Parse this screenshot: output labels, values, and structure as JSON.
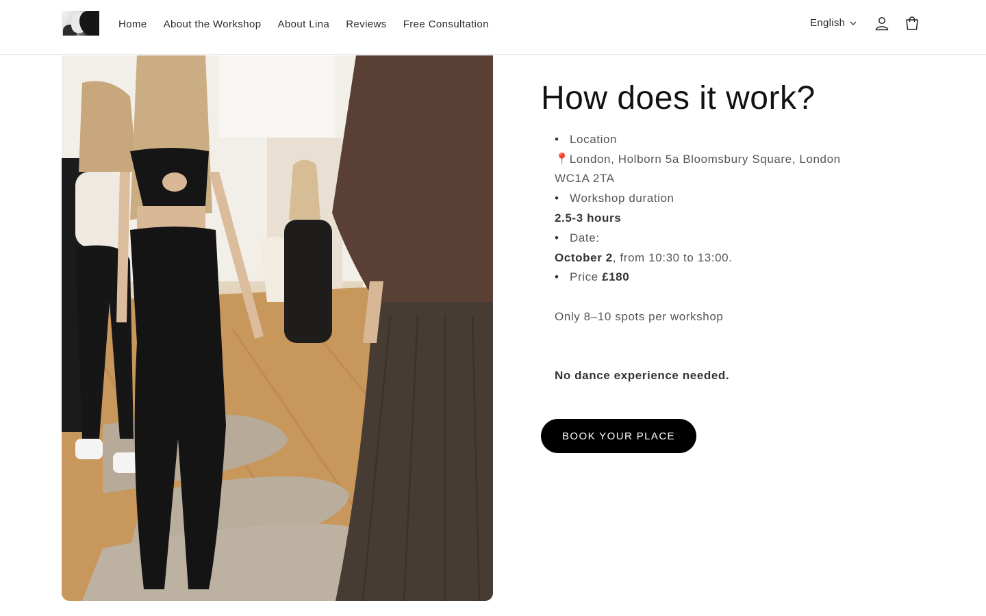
{
  "header": {
    "nav": [
      "Home",
      "About the Workshop",
      "About Lina",
      "Reviews",
      "Free Consultation"
    ],
    "language": "English",
    "icons": {
      "account": "account-icon",
      "cart": "cart-icon",
      "language_chevron": "chevron-down-icon"
    }
  },
  "main": {
    "title": "How does it work?",
    "location_label": "Location",
    "location_pin": "📍",
    "location_line1": "London, Holborn 5a Bloomsbury Square, London",
    "location_line2": "WC1A 2TA",
    "duration_label": "Workshop duration",
    "duration_value": "2.5-3 hours",
    "date_label": "Date:",
    "date_value": "October 2",
    "date_rest": ", from 10:30 to 13:00.",
    "price_label": "Price",
    "price_value": "£180",
    "spots": "Only 8–10 spots per workshop",
    "experience": "No dance experience needed.",
    "book_button": "BOOK YOUR PLACE"
  },
  "colors": {
    "button_bg": "#000000",
    "text": "#121212",
    "muted": "#555555"
  }
}
